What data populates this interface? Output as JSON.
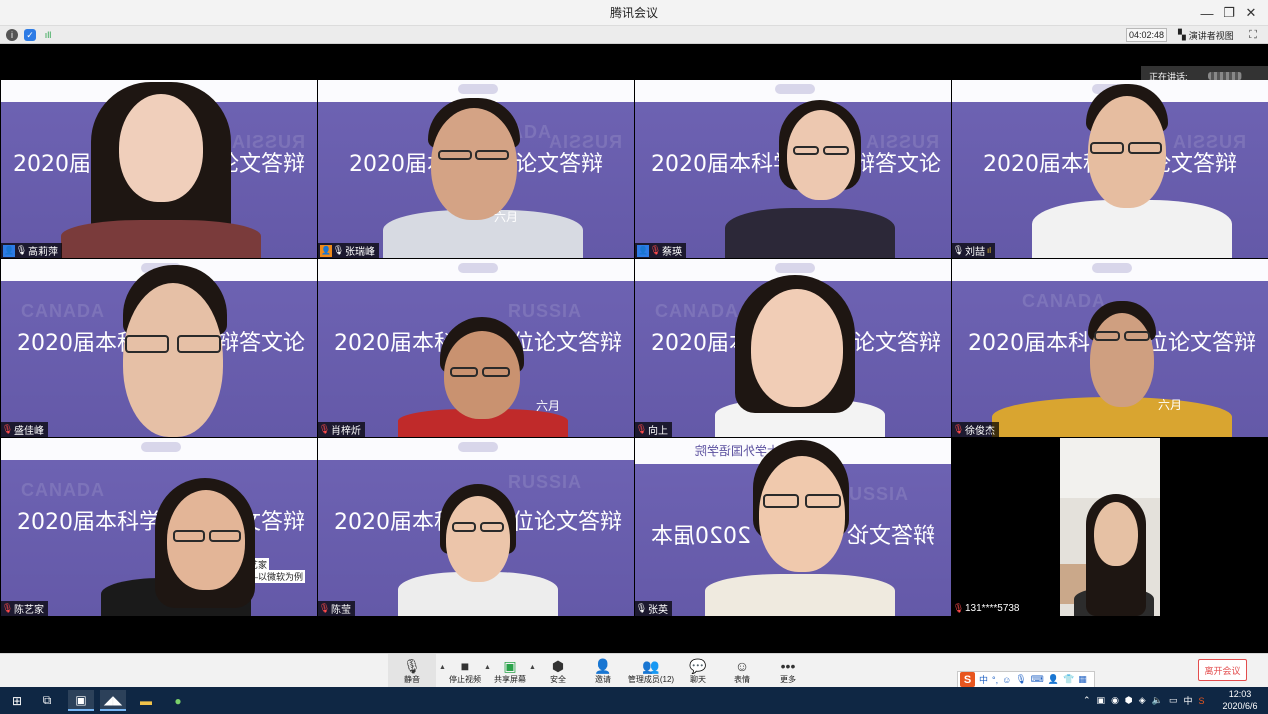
{
  "window": {
    "title": "腾讯会议",
    "minimize_icon": "minimize-icon",
    "restore_icon": "restore-icon",
    "close_icon": "close-icon"
  },
  "infobar": {
    "timer": "04:02:48",
    "speaker_view_label": "演讲者视图"
  },
  "speaking_label": "正在讲话:",
  "slide": {
    "title_line": "2020届本科学位论文答辩",
    "partial": {
      "t1": "2020届本",
      "t1b": "论文答辩",
      "t2": "2020届本科学位论文答辩",
      "t3": "2020届本科学",
      "t3b": "辩答文论",
      "t4": "2020届本科学位论文答辩",
      "t5": "2020届本科",
      "t5b": "辩答文论",
      "t6": "2020届本科",
      "t6b": "位论文答辩",
      "t7": "2020届本",
      "t7b": "位论文答辩",
      "t8": "2020届本科",
      "t8b": "位论文答辩",
      "t9": "2020届本科学",
      "t9b": "辩答文论",
      "t10": "2020届本科",
      "t10b": "位论文答辩",
      "t11": "2020届本",
      "t11b": "学位论文答辩",
      "date_fragment": "六月",
      "note1": "艺家",
      "note2": "—以微软为例",
      "mirror_header": "南京大学外国语学院"
    }
  },
  "participants": [
    {
      "name": "高莉萍",
      "role": "host",
      "muted": false
    },
    {
      "name": "张瑞峰",
      "role": "cohost",
      "muted": false
    },
    {
      "name": "蔡瑛",
      "role": "host",
      "muted": true
    },
    {
      "name": "刘喆",
      "role": "none",
      "muted": false,
      "level": "ıl"
    },
    {
      "name": "盛佳峰",
      "role": "none",
      "muted": true
    },
    {
      "name": "肖梓炘",
      "role": "none",
      "muted": true
    },
    {
      "name": "向上",
      "role": "none",
      "muted": true
    },
    {
      "name": "徐俊杰",
      "role": "none",
      "muted": true
    },
    {
      "name": "陈艺家",
      "role": "none",
      "muted": true
    },
    {
      "name": "陈莹",
      "role": "none",
      "muted": true
    },
    {
      "name": "张英",
      "role": "none",
      "muted": false
    },
    {
      "name": "131****5738",
      "role": "none",
      "muted": true
    }
  ],
  "toolbar": {
    "mute": "静音",
    "stop_video": "停止视频",
    "share_screen": "共享屏幕",
    "security": "安全",
    "invite": "邀请",
    "manage_members": "管理成员(12)",
    "chat": "聊天",
    "reactions": "表情",
    "more": "更多",
    "leave": "离开会议"
  },
  "ime": {
    "logo": "S",
    "mode": "中"
  },
  "taskbar": {
    "time": "12:03",
    "date": "2020/6/6",
    "lang": "中"
  }
}
